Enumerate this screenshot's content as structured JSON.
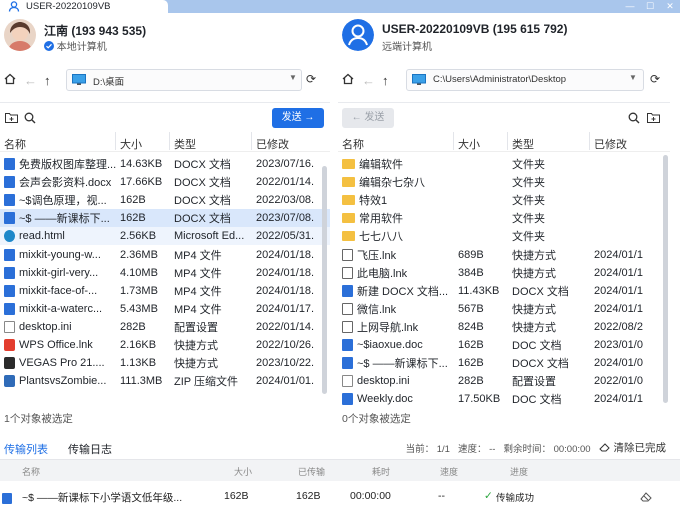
{
  "window": {
    "tab_title": "USER-20220109VB",
    "min": "—",
    "max": "☐",
    "close": "✕"
  },
  "left": {
    "user_name": "江南 (193 943 535)",
    "user_sub": "本地计算机",
    "path": "D:\\桌面",
    "send_label": "发送",
    "headers": [
      "名称",
      "大小",
      "类型",
      "已修改"
    ],
    "files": [
      {
        "name": "免费版权图库整理...",
        "size": "14.63KB",
        "type": "DOCX 文档",
        "mod": "2023/07/16.",
        "icon": "doc"
      },
      {
        "name": "会声会影资料.docx",
        "size": "17.66KB",
        "type": "DOCX 文档",
        "mod": "2022/01/14.",
        "icon": "doc"
      },
      {
        "name": "~$调色原理，视...",
        "size": "162B",
        "type": "DOCX 文档",
        "mod": "2022/03/08.",
        "icon": "doc"
      },
      {
        "name": "~$ ——新课标下...",
        "size": "162B",
        "type": "DOCX 文档",
        "mod": "2023/07/08.",
        "icon": "doc",
        "sel": true
      },
      {
        "name": "read.html",
        "size": "2.56KB",
        "type": "Microsoft Ed...",
        "mod": "2022/05/31.",
        "icon": "edge",
        "hov": true
      },
      {
        "name": "mixkit-young-w...",
        "size": "2.36MB",
        "type": "MP4 文件",
        "mod": "2024/01/18.",
        "icon": "doc"
      },
      {
        "name": "mixkit-girl-very...",
        "size": "4.10MB",
        "type": "MP4 文件",
        "mod": "2024/01/18.",
        "icon": "doc"
      },
      {
        "name": "mixkit-face-of-...",
        "size": "1.73MB",
        "type": "MP4 文件",
        "mod": "2024/01/18.",
        "icon": "doc"
      },
      {
        "name": "mixkit-a-waterc...",
        "size": "5.43MB",
        "type": "MP4 文件",
        "mod": "2024/01/17.",
        "icon": "doc"
      },
      {
        "name": "desktop.ini",
        "size": "282B",
        "type": "配置设置",
        "mod": "2022/01/14.",
        "icon": "file"
      },
      {
        "name": "WPS Office.lnk",
        "size": "2.16KB",
        "type": "快捷方式",
        "mod": "2022/10/26.",
        "icon": "wps"
      },
      {
        "name": "VEGAS Pro 21....",
        "size": "1.13KB",
        "type": "快捷方式",
        "mod": "2023/10/22.",
        "icon": "vegas"
      },
      {
        "name": "PlantsvsZombie...",
        "size": "111.3MB",
        "type": "ZIP 压缩文件",
        "mod": "2024/01/01.",
        "icon": "zip"
      }
    ],
    "status": "1个对象被选定"
  },
  "right": {
    "user_name": "USER-20220109VB (195 615 792)",
    "user_sub": "远端计算机",
    "path": "C:\\Users\\Administrator\\Desktop",
    "send_label": "发送",
    "headers": [
      "名称",
      "大小",
      "类型",
      "已修改"
    ],
    "files": [
      {
        "name": "编辑软件",
        "size": "",
        "type": "文件夹",
        "mod": "",
        "icon": "folder"
      },
      {
        "name": "编辑杂七杂八",
        "size": "",
        "type": "文件夹",
        "mod": "",
        "icon": "folder"
      },
      {
        "name": "特效1",
        "size": "",
        "type": "文件夹",
        "mod": "",
        "icon": "folder"
      },
      {
        "name": "常用软件",
        "size": "",
        "type": "文件夹",
        "mod": "",
        "icon": "folder"
      },
      {
        "name": "七七八八",
        "size": "",
        "type": "文件夹",
        "mod": "",
        "icon": "folder"
      },
      {
        "name": "飞压.lnk",
        "size": "689B",
        "type": "快捷方式",
        "mod": "2024/01/1",
        "icon": "lnk"
      },
      {
        "name": "此电脑.lnk",
        "size": "384B",
        "type": "快捷方式",
        "mod": "2024/01/1",
        "icon": "lnk"
      },
      {
        "name": "新建 DOCX 文档...",
        "size": "11.43KB",
        "type": "DOCX 文档",
        "mod": "2024/01/1",
        "icon": "doc"
      },
      {
        "name": "微信.lnk",
        "size": "567B",
        "type": "快捷方式",
        "mod": "2024/01/1",
        "icon": "lnk"
      },
      {
        "name": "上网导航.lnk",
        "size": "824B",
        "type": "快捷方式",
        "mod": "2022/08/2",
        "icon": "lnk"
      },
      {
        "name": "~$iaoxue.doc",
        "size": "162B",
        "type": "DOC 文档",
        "mod": "2023/01/0",
        "icon": "doc"
      },
      {
        "name": "~$ ——新课标下...",
        "size": "162B",
        "type": "DOCX 文档",
        "mod": "2024/01/0",
        "icon": "doc"
      },
      {
        "name": "desktop.ini",
        "size": "282B",
        "type": "配置设置",
        "mod": "2022/01/0",
        "icon": "file"
      },
      {
        "name": "Weekly.doc",
        "size": "17.50KB",
        "type": "DOC 文档",
        "mod": "2024/01/1",
        "icon": "doc"
      }
    ],
    "status": "0个对象被选定"
  },
  "transfer": {
    "tabs": [
      "传输列表",
      "传输日志"
    ],
    "page": "当前： 1/1",
    "speed": "速度： --",
    "remain": "剩余时间： 00:00:00",
    "clear": "清除已完成",
    "headers": [
      "名称",
      "大小",
      "已传输",
      "耗时",
      "速度",
      "进度"
    ],
    "row": {
      "name": "~$ ——新课标下小学语文低年级...",
      "size": "162B",
      "done": "162B",
      "time": "00:00:00",
      "speed": "--",
      "progress": "传输成功"
    }
  },
  "colors": {
    "accent": "#1f6fe5",
    "titlebar": "#a9c6ec",
    "selected": "#d9e7fb",
    "success": "#2aa53d"
  }
}
